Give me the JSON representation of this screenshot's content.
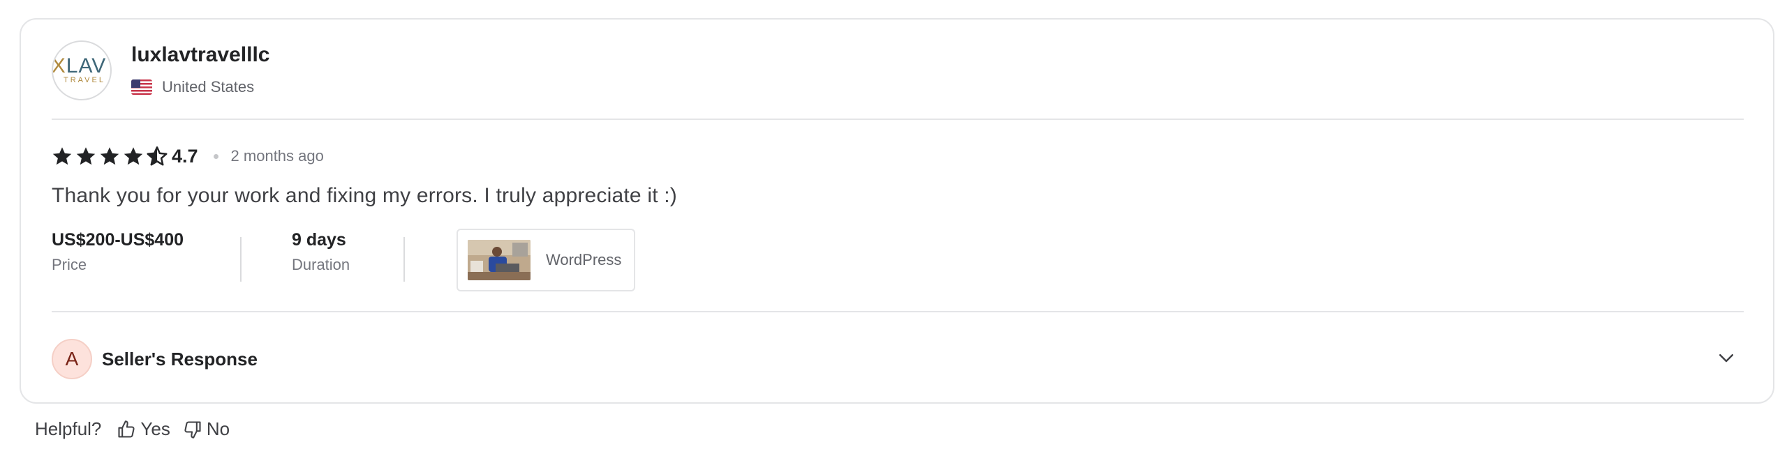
{
  "review": {
    "avatar": {
      "logo_main": "LAV",
      "logo_x": "X",
      "logo_sub": "TRAVEL",
      "icon": "brand-logo"
    },
    "username": "luxlavtravelllc",
    "country": "United States",
    "country_flag_icon": "us-flag-icon",
    "rating": {
      "value": 4.7,
      "display": "4.7",
      "stars_full": 4,
      "star_half": 1
    },
    "time_ago": "2 months ago",
    "comment": "Thank you for your work and fixing my errors. I truly appreciate it :)",
    "price": {
      "value": "US$200-US$400",
      "label": "Price"
    },
    "duration": {
      "value": "9 days",
      "label": "Duration"
    },
    "gig": {
      "label": "WordPress"
    },
    "seller_response": {
      "initial": "A",
      "title": "Seller's Response"
    }
  },
  "helpful": {
    "question": "Helpful?",
    "yes_label": "Yes",
    "no_label": "No"
  },
  "colors": {
    "star": "#222325",
    "border": "#e4e5e7",
    "response_avatar_bg": "#fde2dc"
  }
}
